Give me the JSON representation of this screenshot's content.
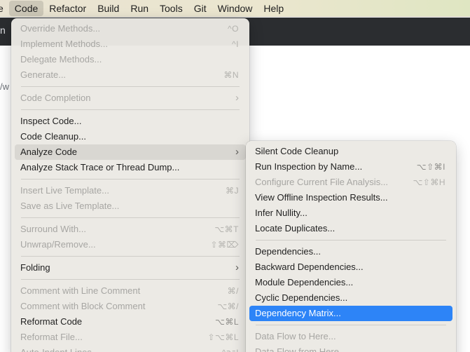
{
  "menubar": {
    "items": [
      {
        "label": "e"
      },
      {
        "label": "Code"
      },
      {
        "label": "Refactor"
      },
      {
        "label": "Build"
      },
      {
        "label": "Run"
      },
      {
        "label": "Tools"
      },
      {
        "label": "Git"
      },
      {
        "label": "Window"
      },
      {
        "label": "Help"
      }
    ]
  },
  "background": {
    "toolbar_char": "n",
    "editor_fragment": "/w"
  },
  "code_menu": {
    "items": [
      {
        "label": "Override Methods...",
        "shortcut": "^O"
      },
      {
        "label": "Implement Methods...",
        "shortcut": "^I"
      },
      {
        "label": "Delegate Methods...",
        "shortcut": ""
      },
      {
        "label": "Generate...",
        "shortcut": "⌘N"
      },
      {
        "label": "Code Completion",
        "shortcut": ""
      },
      {
        "label": "Inspect Code...",
        "shortcut": ""
      },
      {
        "label": "Code Cleanup...",
        "shortcut": ""
      },
      {
        "label": "Analyze Code",
        "shortcut": ""
      },
      {
        "label": "Analyze Stack Trace or Thread Dump...",
        "shortcut": ""
      },
      {
        "label": "Insert Live Template...",
        "shortcut": "⌘J"
      },
      {
        "label": "Save as Live Template...",
        "shortcut": ""
      },
      {
        "label": "Surround With...",
        "shortcut": "⌥⌘T"
      },
      {
        "label": "Unwrap/Remove...",
        "shortcut": "⇧⌘⌦"
      },
      {
        "label": "Folding",
        "shortcut": ""
      },
      {
        "label": "Comment with Line Comment",
        "shortcut": "⌘/"
      },
      {
        "label": "Comment with Block Comment",
        "shortcut": "⌥⌘/"
      },
      {
        "label": "Reformat Code",
        "shortcut": "⌥⌘L"
      },
      {
        "label": "Reformat File...",
        "shortcut": "⇧⌥⌘L"
      },
      {
        "label": "Auto-Indent Lines",
        "shortcut": "^⌥I"
      }
    ]
  },
  "analyze_submenu": {
    "items": [
      {
        "label": "Silent Code Cleanup",
        "shortcut": ""
      },
      {
        "label": "Run Inspection by Name...",
        "shortcut": "⌥⇧⌘I"
      },
      {
        "label": "Configure Current File Analysis...",
        "shortcut": "⌥⇧⌘H"
      },
      {
        "label": "View Offline Inspection Results...",
        "shortcut": ""
      },
      {
        "label": "Infer Nullity...",
        "shortcut": ""
      },
      {
        "label": "Locate Duplicates...",
        "shortcut": ""
      },
      {
        "label": "Dependencies...",
        "shortcut": ""
      },
      {
        "label": "Backward Dependencies...",
        "shortcut": ""
      },
      {
        "label": "Module Dependencies...",
        "shortcut": ""
      },
      {
        "label": "Cyclic Dependencies...",
        "shortcut": ""
      },
      {
        "label": "Dependency Matrix...",
        "shortcut": ""
      },
      {
        "label": "Data Flow to Here...",
        "shortcut": ""
      },
      {
        "label": "Data Flow from Here...",
        "shortcut": ""
      }
    ]
  },
  "colors": {
    "selection": "#2d84f7",
    "menu_bg": "#ebe9e4",
    "dark_toolbar": "#2b2d30"
  }
}
